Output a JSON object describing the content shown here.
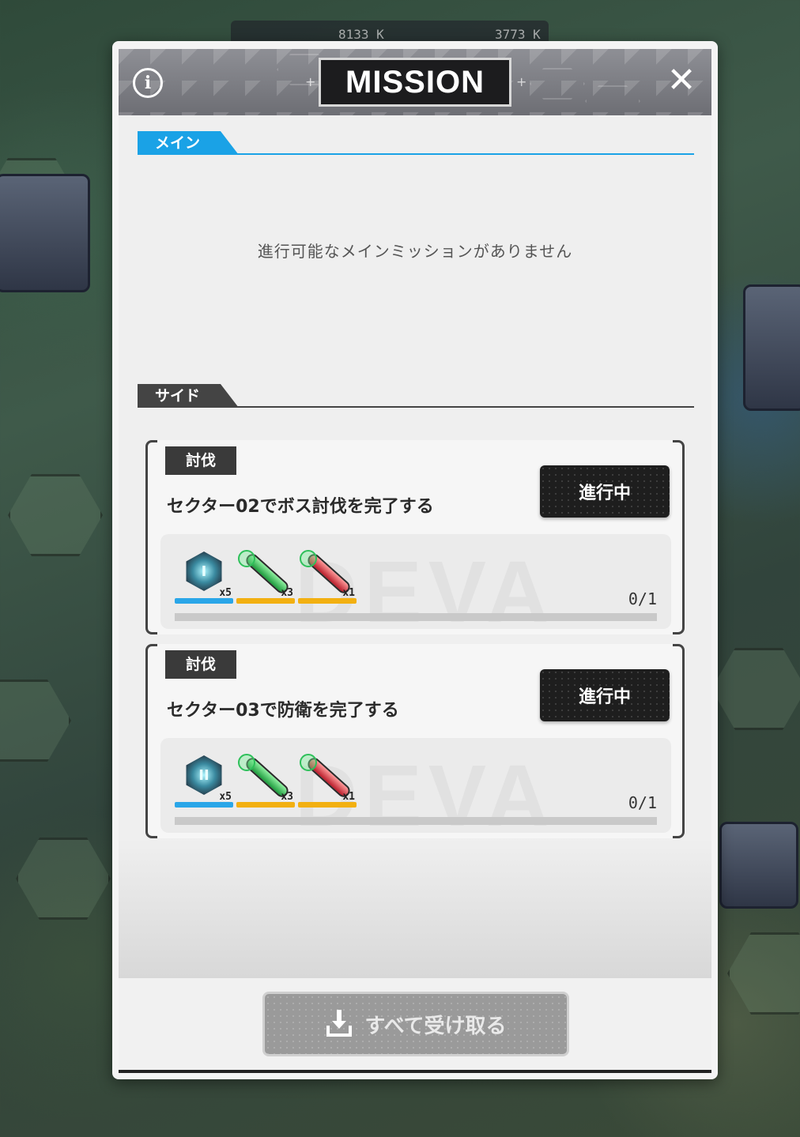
{
  "background": {
    "top_values": [
      "8133 K",
      "3773 K"
    ]
  },
  "header": {
    "title": "MISSION",
    "info_icon": "info-icon",
    "close_icon": "close-icon"
  },
  "main_section": {
    "label": "メイン",
    "empty_message": "進行可能なメインミッションがありません",
    "color": "#1aa2e6"
  },
  "side_section": {
    "label": "サイド",
    "missions": [
      {
        "tag": "討伐",
        "text": "セクター02でボス討伐を完了する",
        "status": "進行中",
        "progress": "0/1",
        "rewards": [
          {
            "icon": "crystal-icon",
            "count": "x5",
            "bar_color": "#2aa6e8"
          },
          {
            "icon": "green-tube-icon",
            "count": "x3",
            "bar_color": "#f2b011"
          },
          {
            "icon": "red-tube-icon",
            "count": "x1",
            "bar_color": "#f2b011"
          }
        ]
      },
      {
        "tag": "討伐",
        "text": "セクター03で防衛を完了する",
        "status": "進行中",
        "progress": "0/1",
        "rewards": [
          {
            "icon": "crystal-icon",
            "count": "x5",
            "bar_color": "#2aa6e8"
          },
          {
            "icon": "green-tube-icon",
            "count": "x3",
            "bar_color": "#f2b011"
          },
          {
            "icon": "red-tube-icon",
            "count": "x1",
            "bar_color": "#f2b011"
          }
        ]
      }
    ]
  },
  "footer": {
    "claim_all_label": "すべて受け取る"
  }
}
